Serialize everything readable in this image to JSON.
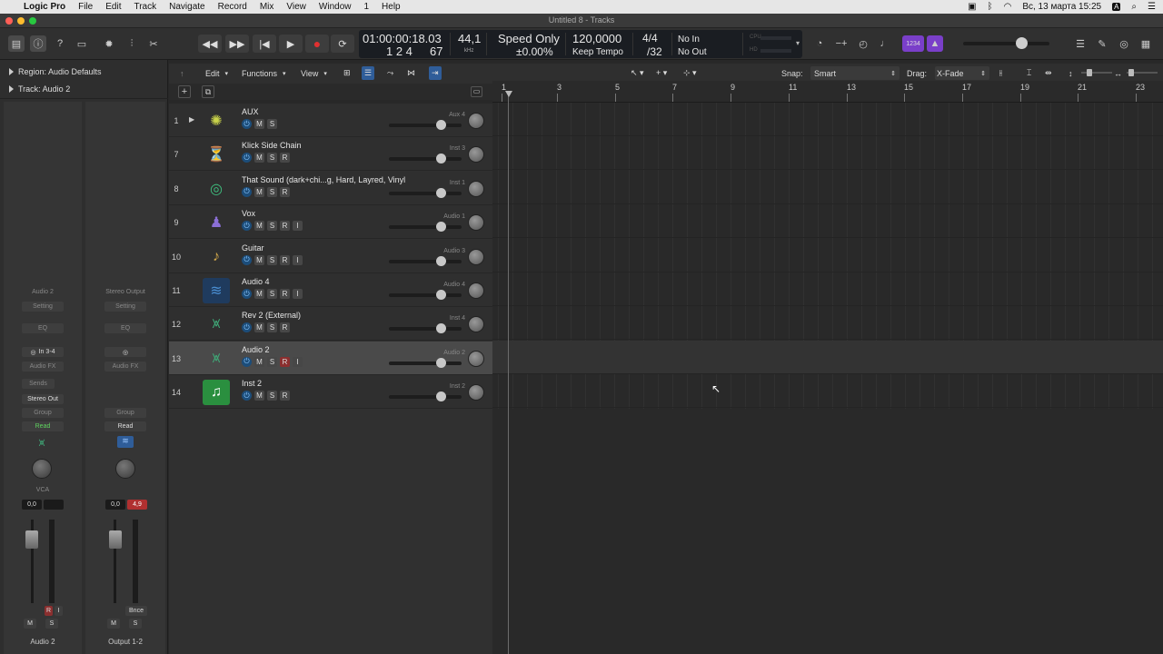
{
  "menubar": {
    "app": "Logic Pro",
    "items": [
      "File",
      "Edit",
      "Track",
      "Navigate",
      "Record",
      "Mix",
      "View",
      "Window",
      "1",
      "Help"
    ],
    "clock": "Вс, 13 марта  15:25",
    "input_lang": "A"
  },
  "window": {
    "title": "Untitled 8 - Tracks"
  },
  "lcd": {
    "time": "01:00:00:18.03",
    "bars": "1  2  4",
    "bars_sub": "67",
    "rate": "44,1",
    "rate_unit": "kHz",
    "mode": "Speed Only",
    "mode_pct": "±0.00%",
    "tempo": "120,0000",
    "tempo_mode": "Keep Tempo",
    "sig": "4/4",
    "div": "/32",
    "in": "No In",
    "out": "No Out",
    "cpu": "CPU",
    "hd": "HD"
  },
  "control": {
    "smart_badge": "1234"
  },
  "inspector": {
    "region_label": "Region: Audio Defaults",
    "track_label": "Track: Audio 2",
    "strip1": {
      "name": "Audio 2",
      "setting": "Setting",
      "eq": "EQ",
      "input": "In 3-4",
      "audio_fx": "Audio FX",
      "sends": "Sends",
      "output": "Stereo Out",
      "group": "Group",
      "mode": "Read",
      "vca": "VCA",
      "vol": "0,0",
      "peak": "",
      "m": "M",
      "s": "S",
      "r": "R",
      "i": "I",
      "bottom": "Audio 2"
    },
    "strip2": {
      "name": "Stereo Output",
      "setting": "Setting",
      "eq": "EQ",
      "audio_fx": "Audio FX",
      "group": "Group",
      "mode": "Read",
      "vol": "0,0",
      "peak": "4,9",
      "m": "M",
      "s": "S",
      "bnce": "Bnce",
      "bottom": "Output 1-2"
    }
  },
  "trackhdr": {
    "edit": "Edit",
    "functions": "Functions",
    "view": "View"
  },
  "arrangehdr": {
    "snap_label": "Snap:",
    "snap_value": "Smart",
    "drag_label": "Drag:",
    "drag_value": "X-Fade"
  },
  "ruler": [
    "1",
    "3",
    "5",
    "7",
    "9",
    "11",
    "13",
    "15",
    "17",
    "19",
    "21",
    "23"
  ],
  "tracks": [
    {
      "num": "1",
      "name": "AUX",
      "inst": "Aux 4",
      "buttons": [
        "M",
        "S"
      ],
      "icon": "aux-icon",
      "color": "#c9d34a",
      "folder": true
    },
    {
      "num": "7",
      "name": "Klick Side Chain",
      "inst": "Inst 3",
      "buttons": [
        "M",
        "S",
        "R"
      ],
      "icon": "metronome-icon",
      "color": "#4aa3d3"
    },
    {
      "num": "8",
      "name": "That Sound (dark+chi...g, Hard, Layred, Vinyl",
      "inst": "Inst 1",
      "buttons": [
        "M",
        "S",
        "R"
      ],
      "icon": "sampler-icon",
      "color": "#3fbf7f"
    },
    {
      "num": "9",
      "name": "Vox",
      "inst": "Audio 1",
      "buttons": [
        "M",
        "S",
        "R",
        "I"
      ],
      "icon": "singer-icon",
      "color": "#8b6fd6"
    },
    {
      "num": "10",
      "name": "Guitar",
      "inst": "Audio 3",
      "buttons": [
        "M",
        "S",
        "R",
        "I"
      ],
      "icon": "guitar-icon",
      "color": "#d3a84a"
    },
    {
      "num": "11",
      "name": "Audio 4",
      "inst": "Audio 4",
      "buttons": [
        "M",
        "S",
        "R",
        "I"
      ],
      "icon": "waveform-icon",
      "color": "#4a8fd3"
    },
    {
      "num": "12",
      "name": "Rev 2 (External)",
      "inst": "Inst 4",
      "buttons": [
        "M",
        "S",
        "R"
      ],
      "icon": "keyboard-stand-icon",
      "color": "#3fa877"
    },
    {
      "num": "13",
      "name": "Audio 2",
      "inst": "Audio 2",
      "buttons": [
        "M",
        "S",
        "R",
        "I"
      ],
      "icon": "keyboard-stand-icon",
      "color": "#3fa877",
      "selected": true
    },
    {
      "num": "14",
      "name": "Inst 2",
      "inst": "Inst 2",
      "buttons": [
        "M",
        "S",
        "R"
      ],
      "icon": "music-note-icon",
      "color": "#2fbf4f"
    }
  ]
}
